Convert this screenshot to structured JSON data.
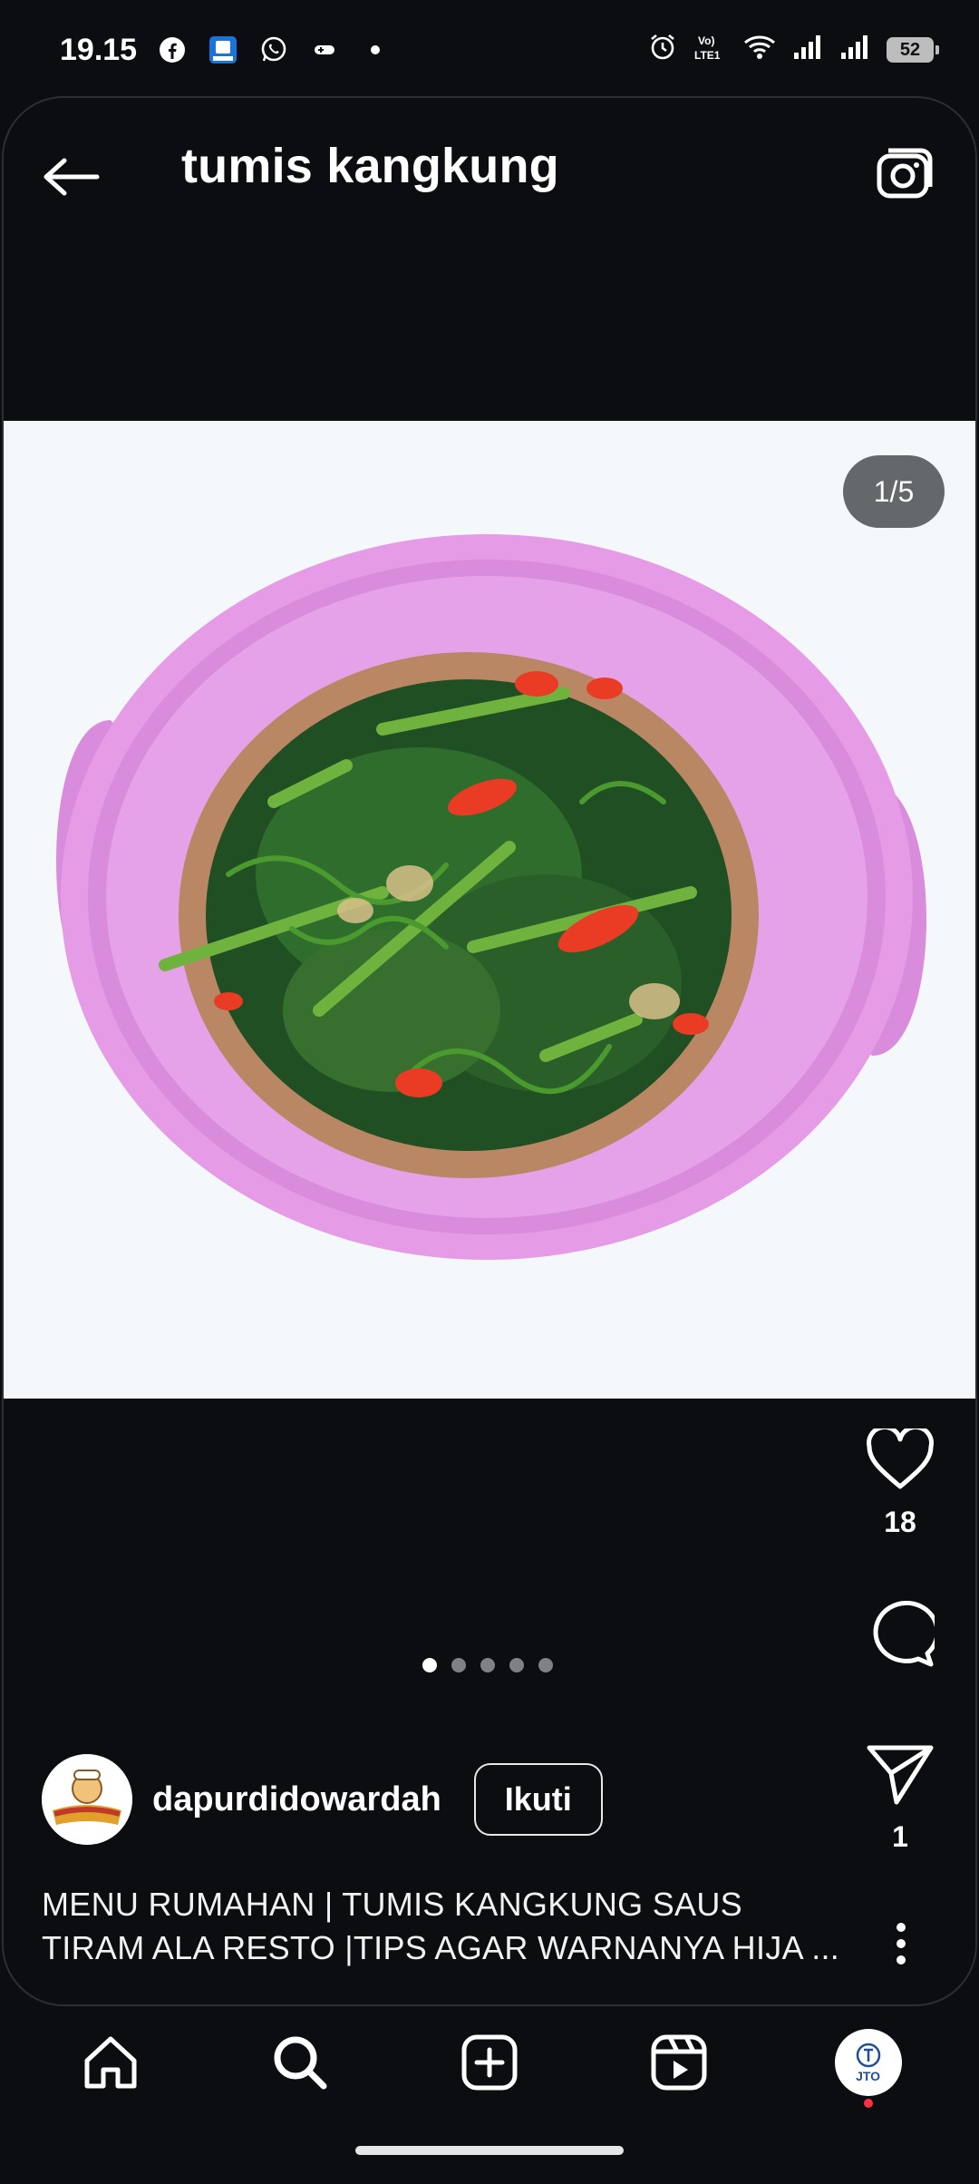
{
  "status_bar": {
    "time": "19.15",
    "battery": "52",
    "icons": [
      "facebook-icon",
      "app-icon",
      "whatsapp-icon",
      "game-icon",
      "dot-icon",
      "alarm-icon",
      "volte-icon",
      "wifi-icon",
      "signal-icon",
      "signal-icon-2"
    ]
  },
  "header": {
    "title": "tumis kangkung",
    "back_icon": "arrow-left-icon",
    "camera_icon": "camera-icon"
  },
  "post": {
    "page_indicator": "1/5",
    "total_slides": 5,
    "active_slide": 1,
    "likes": "18",
    "shares": "1"
  },
  "author": {
    "username": "dapurdidowardah",
    "follow_label": "Ikuti"
  },
  "caption": {
    "line1": "MENU RUMAHAN | TUMIS KANGKUNG SAUS",
    "line2": "TIRAM ALA RESTO |TIPS AGAR WARNANYA HIJA ..."
  },
  "nav": {
    "items": [
      "home-icon",
      "search-icon",
      "add-post-icon",
      "reels-icon",
      "profile-avatar"
    ],
    "profile_label": "JTO"
  },
  "colors": {
    "background": "#0b0d10",
    "plate": "#e59be6",
    "notification": "#ff3040"
  }
}
